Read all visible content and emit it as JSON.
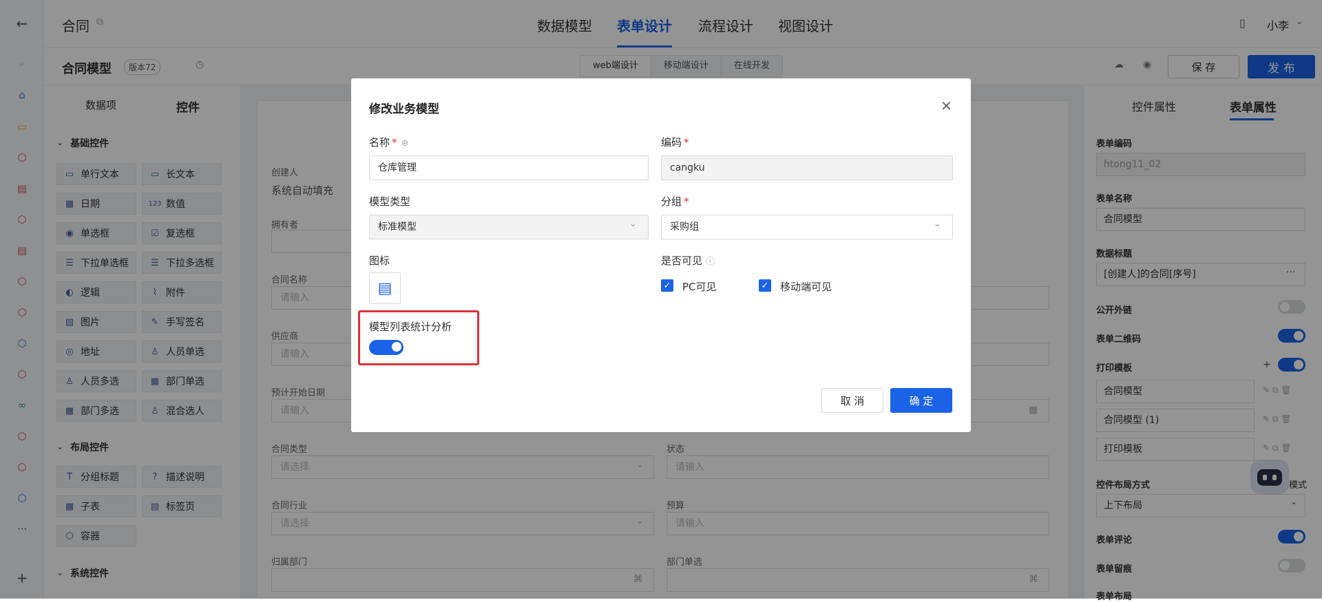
{
  "topbar": {
    "doc_title": "合同",
    "tabs": [
      "数据模型",
      "表单设计",
      "流程设计",
      "视图设计"
    ],
    "active_tab": "表单设计",
    "user": "小李"
  },
  "subbar": {
    "model_title": "合同模型",
    "version": "版本72",
    "segments": [
      "web端设计",
      "移动端设计",
      "在线开发"
    ],
    "save_label": "保 存",
    "publish_label": "发 布"
  },
  "left_panel": {
    "tabs": [
      "数据项",
      "控件"
    ],
    "basic_title": "基础控件",
    "basic_items": [
      "单行文本",
      "长文本",
      "日期",
      "数值",
      "单选框",
      "复选框",
      "下拉单选框",
      "下拉多选框",
      "逻辑",
      "附件",
      "图片",
      "手写签名",
      "地址",
      "人员单选",
      "人员多选",
      "部门单选",
      "部门多选",
      "混合选人"
    ],
    "layout_title": "布局控件",
    "layout_items": [
      "分组标题",
      "描述说明",
      "子表",
      "标签页",
      "容器"
    ],
    "system_title": "系统控件"
  },
  "form": {
    "creator_label": "创建人",
    "creator_value": "系统自动填充",
    "owner_label": "拥有者",
    "contract_name_label": "合同名称",
    "supplier_label": "供应商",
    "start_date_label": "预计开始日期",
    "contract_type_label": "合同类型",
    "status_label": "状态",
    "industry_label": "合同行业",
    "budget_label": "预算",
    "dept_label": "归属部门",
    "dept_single_label": "部门单选",
    "placeholder_input": "请输入",
    "placeholder_select": "请选择"
  },
  "right_panel": {
    "tabs": [
      "控件属性",
      "表单属性"
    ],
    "form_code_label": "表单编码",
    "form_code_value": "htong11_02",
    "form_name_label": "表单名称",
    "form_name_value": "合同模型",
    "data_title_label": "数据标题",
    "data_title_value": "[创建人]的合同[序号]",
    "public_link_label": "公开外链",
    "qr_label": "表单二维码",
    "print_label": "打印模板",
    "print_templates": [
      "合同模型",
      "合同模型 (1)",
      "打印模板"
    ],
    "layout_label": "控件布局方式",
    "layout_suffix": "模式",
    "layout_value": "上下布局",
    "comment_label": "表单评论",
    "trace_label": "表单留痕",
    "form_layout_label": "表单布局",
    "toggles": {
      "public_link": false,
      "qr": true,
      "print": true,
      "comment": true,
      "trace": false
    }
  },
  "modal": {
    "title": "修改业务模型",
    "name_label": "名称",
    "name_value": "仓库管理",
    "code_label": "编码",
    "code_value": "cangku",
    "type_label": "模型类型",
    "type_value": "标准模型",
    "group_label": "分组",
    "group_value": "采购组",
    "icon_label": "图标",
    "visible_label": "是否可见",
    "pc_visible": "PC可见",
    "mobile_visible": "移动端可见",
    "stats_label": "模型列表统计分析",
    "stats_on": true,
    "cancel_label": "取 消",
    "ok_label": "确 定"
  },
  "colors": {
    "accent": "#1b63e6",
    "highlight": "#e0303a",
    "rail_icon": "#cc5a6a"
  }
}
